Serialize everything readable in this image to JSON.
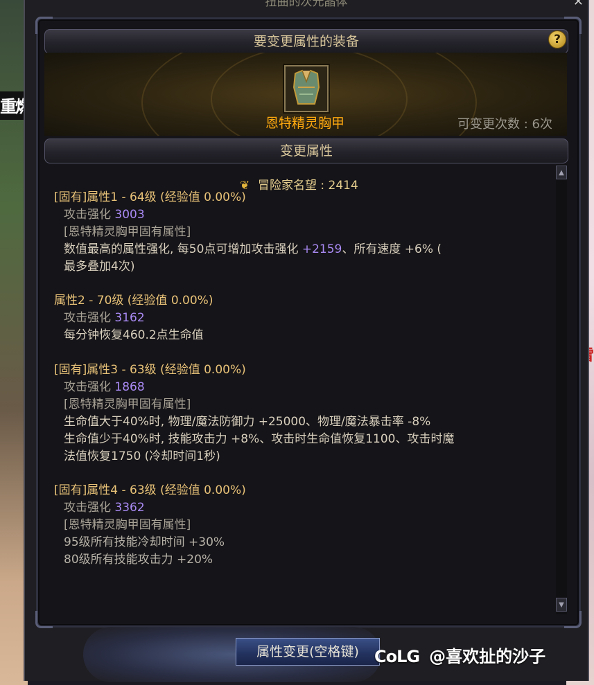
{
  "window": {
    "title": "扭曲的次元晶体",
    "close_icon": "close-icon"
  },
  "background": {
    "left_text": "重燃",
    "right_text": "雪"
  },
  "equipment_section": {
    "title": "要变更属性的装备",
    "help_label": "?",
    "item_name": "恩特精灵胸甲",
    "change_count": "可变更次数 : 6次"
  },
  "attributes_section": {
    "title": "变更属性",
    "reputation": "冒险家名望 : 2414",
    "blocks": [
      {
        "heading": "[固有]属性1 - 64级 (经验值 0.00%)",
        "strength_label": "攻击强化",
        "strength_value": "3003",
        "tag": "[恩特精灵胸甲固有属性]",
        "lines": [
          {
            "a": "数值最高的属性强化, 每50点可增加攻击强化 ",
            "b": "+2159",
            "c": "、所有速度 +6% ("
          },
          {
            "a": "最多叠加4次)",
            "b": "",
            "c": ""
          }
        ]
      },
      {
        "heading": "属性2 - 70级 (经验值 0.00%)",
        "strength_label": "攻击强化",
        "strength_value": "3162",
        "tag": "",
        "lines": [
          {
            "a": "每分钟恢复460.2点生命值",
            "b": "",
            "c": ""
          }
        ]
      },
      {
        "heading": "[固有]属性3 - 63级 (经验值 0.00%)",
        "strength_label": "攻击强化",
        "strength_value": "1868",
        "tag": "[恩特精灵胸甲固有属性]",
        "lines": [
          {
            "a": "生命值大于40%时, 物理/魔法防御力 +25000、物理/魔法暴击率 -8%",
            "b": "",
            "c": ""
          },
          {
            "a": "生命值少于40%时, 技能攻击力 +8%、攻击时生命值恢复1100、攻击时魔",
            "b": "",
            "c": ""
          },
          {
            "a": "法值恢复1750 (冷却时间1秒)",
            "b": "",
            "c": ""
          }
        ]
      },
      {
        "heading": "[固有]属性4 - 63级 (经验值 0.00%)",
        "strength_label": "攻击强化",
        "strength_value": "3362",
        "tag": "[恩特精灵胸甲固有属性]",
        "lines": [
          {
            "a": "95级所有技能冷却时间 +30%",
            "b": "",
            "c": ""
          },
          {
            "a": "80级所有技能攻击力 +20%",
            "b": "",
            "c": ""
          }
        ]
      }
    ]
  },
  "buttons": {
    "change_attribute": "属性变更(空格键)"
  },
  "watermark": {
    "brand": "CoLG",
    "user": "@喜欢扯的沙子"
  },
  "colors": {
    "heading": "#e8c278",
    "item_name": "#ffa90f",
    "value_purple": "#a98af4"
  }
}
